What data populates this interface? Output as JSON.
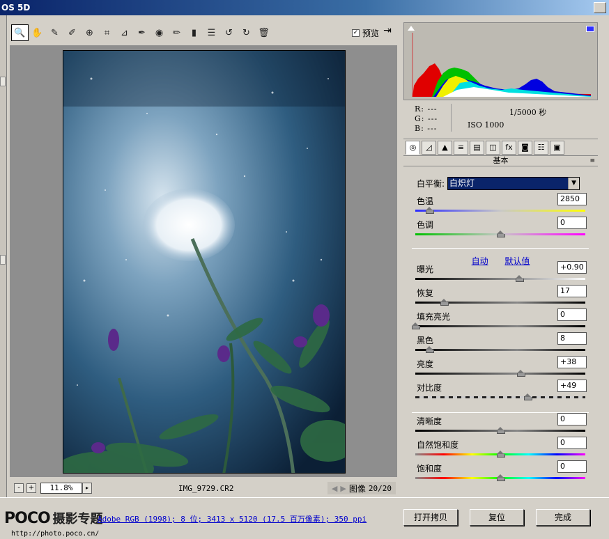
{
  "window": {
    "title": "OS 5D"
  },
  "toolbar": {
    "tools": [
      {
        "name": "zoom-tool-icon",
        "glyph": "🔍"
      },
      {
        "name": "hand-tool-icon",
        "glyph": "✋"
      },
      {
        "name": "white-balance-tool-icon",
        "glyph": "✎"
      },
      {
        "name": "color-sampler-tool-icon",
        "glyph": "✐"
      },
      {
        "name": "target-adjustment-tool-icon",
        "glyph": "⊕"
      },
      {
        "name": "crop-tool-icon",
        "glyph": "⌗"
      },
      {
        "name": "straighten-tool-icon",
        "glyph": "⊿"
      },
      {
        "name": "spot-removal-tool-icon",
        "glyph": "✒"
      },
      {
        "name": "red-eye-tool-icon",
        "glyph": "◉"
      },
      {
        "name": "adjustment-brush-icon",
        "glyph": "✏"
      },
      {
        "name": "graduated-filter-icon",
        "glyph": "▮"
      },
      {
        "name": "preferences-icon",
        "glyph": "☰"
      },
      {
        "name": "rotate-left-icon",
        "glyph": "↺"
      },
      {
        "name": "rotate-right-icon",
        "glyph": "↻"
      },
      {
        "name": "delete-icon",
        "glyph": "🗑"
      }
    ],
    "preview_label": "预览",
    "preview_checked": "✓"
  },
  "bottom": {
    "zoom_minus": "-",
    "zoom_plus": "+",
    "zoom_value": "11.8%",
    "zoom_arrow": "▸",
    "filename": "IMG_9729.CR2",
    "prev_arrow": "◀",
    "next_arrow": "▶",
    "image_label": "图像",
    "image_count": "20/20"
  },
  "info": {
    "r": "R: ---",
    "g": "G: ---",
    "b": "B: ---",
    "shutter": "1/5000 秒",
    "iso": "ISO 1000"
  },
  "tabs": [
    "◎",
    "◿",
    "▲",
    "≡",
    "▤",
    "◫",
    "fx",
    "◙",
    "☷",
    "▣"
  ],
  "panel": {
    "title": "基本",
    "menu_glyph": "≡",
    "wb_label": "白平衡:",
    "wb_value": "白炽灯",
    "wb_arrow": "▼",
    "auto_label": "自动",
    "default_label": "默认值"
  },
  "sliders": [
    {
      "label": "色温",
      "value": "2850",
      "pos": 0.08,
      "track": "temp"
    },
    {
      "label": "色调",
      "value": "0",
      "pos": 0.5,
      "track": "tint"
    },
    {
      "label": "曝光",
      "value": "+0.90",
      "pos": 0.61,
      "track": "exposure"
    },
    {
      "label": "恢复",
      "value": "17",
      "pos": 0.17,
      "track": "dark"
    },
    {
      "label": "填充亮光",
      "value": "0",
      "pos": 0.0,
      "track": "dark"
    },
    {
      "label": "黑色",
      "value": "8",
      "pos": 0.08,
      "track": "dark"
    },
    {
      "label": "亮度",
      "value": "+38",
      "pos": 0.62,
      "track": "dark"
    },
    {
      "label": "对比度",
      "value": "+49",
      "pos": 0.66,
      "track": "contrast"
    },
    {
      "label": "清晰度",
      "value": "0",
      "pos": 0.5,
      "track": "dark"
    },
    {
      "label": "自然饱和度",
      "value": "0",
      "pos": 0.5,
      "track": "rainbow"
    },
    {
      "label": "饱和度",
      "value": "0",
      "pos": 0.5,
      "track": "rainbow"
    }
  ],
  "footer": {
    "logo_latin": "POCO",
    "logo_cn": "摄影专题",
    "logo_url": "http://photo.poco.cn/",
    "workflow": "Adobe RGB (1998); 8 位; 3413 x 5120 (17.5 百万像素); 350 ppi",
    "open_copy": "打开拷贝",
    "reset": "复位",
    "done": "完成"
  }
}
